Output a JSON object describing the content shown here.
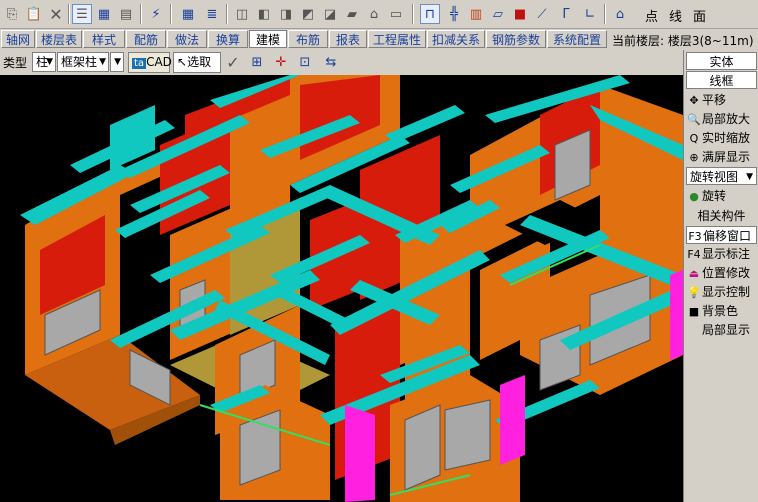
{
  "toolbar": {
    "labels": [
      "点",
      "线",
      "面"
    ]
  },
  "menu": {
    "items": [
      "轴网",
      "楼层表",
      "样式",
      "配筋",
      "做法",
      "换算",
      "建模",
      "布筋",
      "报表",
      "工程属性",
      "扣减关系",
      "钢筋参数",
      "系统配置"
    ],
    "active_index": 6,
    "current_floor": "当前楼层: 楼层3(8~11m)"
  },
  "toolbar2": {
    "type_label": "类型",
    "type_value": "柱",
    "subtype_value": "框架柱",
    "cad_label": "CAD",
    "select_label": "选取"
  },
  "side_panel": {
    "solid": "实体",
    "wireframe": "线框",
    "pan": "平移",
    "zoom_local": "局部放大",
    "zoom_realtime": "实时缩放",
    "fit_screen": "满屏显示",
    "rotate_view": "旋转视图",
    "rotate": "旋转",
    "related": "相关构件",
    "offset_window": "偏移窗口",
    "offset_key": "F3",
    "show_labels": "显示标注",
    "labels_key": "F4",
    "position_edit": "位置修改",
    "display_control": "显示控制",
    "background": "背景色",
    "local_display": "局部显示"
  },
  "colors": {
    "wall_orange": "#e07010",
    "wall_red": "#d81c0c",
    "beam_cyan": "#10c8c0",
    "column_magenta": "#ff20e0",
    "wall_olive": "#b09838",
    "window_gray": "#a8a8a8"
  }
}
